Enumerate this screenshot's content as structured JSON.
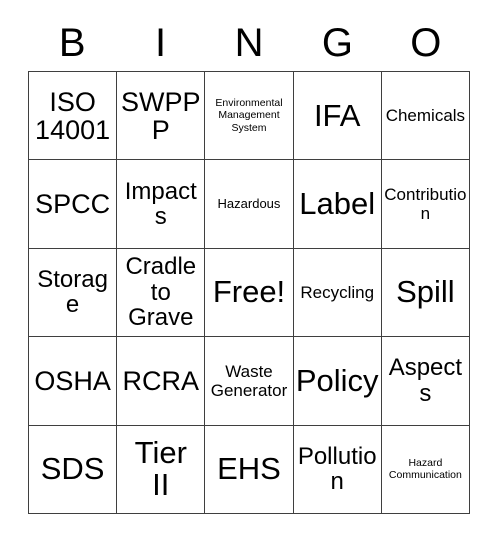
{
  "card": {
    "title": "BINGO",
    "header_letters": [
      "B",
      "I",
      "N",
      "G",
      "O"
    ],
    "free_space_label": "Free!",
    "grid": {
      "columns": 5,
      "rows": 5,
      "cells": [
        [
          {
            "text": "ISO\n14001",
            "size": "xl"
          },
          {
            "text": "SWPPP",
            "size": "xl"
          },
          {
            "text": "Environmental\nManagement\nSystem",
            "size": "xs"
          },
          {
            "text": "IFA",
            "size": "xxl"
          },
          {
            "text": "Chemicals",
            "size": "md"
          }
        ],
        [
          {
            "text": "SPCC",
            "size": "xl"
          },
          {
            "text": "Impacts",
            "size": "lg"
          },
          {
            "text": "Hazardous",
            "size": "sm"
          },
          {
            "text": "Label",
            "size": "xxl"
          },
          {
            "text": "Contribution",
            "size": "md"
          }
        ],
        [
          {
            "text": "Storage",
            "size": "lg"
          },
          {
            "text": "Cradle\nto\nGrave",
            "size": "lg"
          },
          {
            "text": "Free!",
            "size": "xxl"
          },
          {
            "text": "Recycling",
            "size": "md"
          },
          {
            "text": "Spill",
            "size": "xxl"
          }
        ],
        [
          {
            "text": "OSHA",
            "size": "xl"
          },
          {
            "text": "RCRA",
            "size": "xl"
          },
          {
            "text": "Waste\nGenerator",
            "size": "md"
          },
          {
            "text": "Policy",
            "size": "xxl"
          },
          {
            "text": "Aspects",
            "size": "lg"
          }
        ],
        [
          {
            "text": "SDS",
            "size": "xxl"
          },
          {
            "text": "Tier\nII",
            "size": "xxl"
          },
          {
            "text": "EHS",
            "size": "xxl"
          },
          {
            "text": "Pollution",
            "size": "lg"
          },
          {
            "text": "Hazard\nCommunication",
            "size": "xs"
          }
        ]
      ]
    }
  },
  "colors": {
    "background": "#ffffff",
    "text": "#000000",
    "grid_line": "#3f3f3f"
  }
}
